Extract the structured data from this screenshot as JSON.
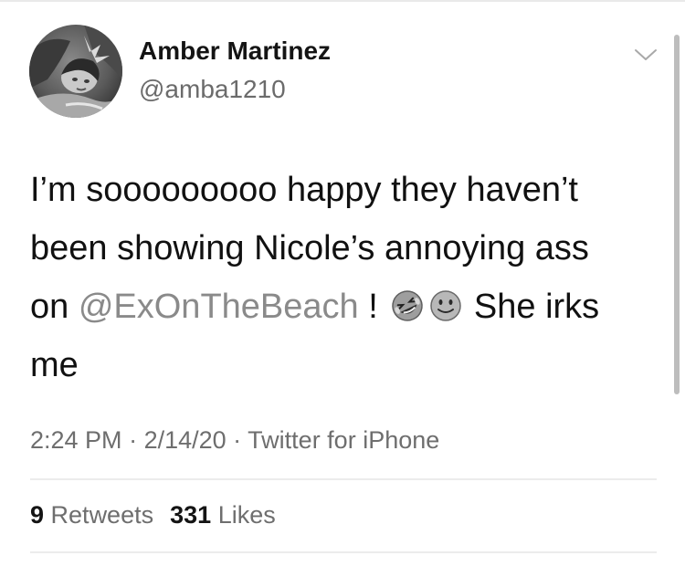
{
  "user": {
    "display_name": "Amber Martinez",
    "handle": "@amba1210"
  },
  "tweet": {
    "line1": "I’m sooooooooo happy they haven’t",
    "line2": "been showing Nicole’s annoying ass",
    "line3_prefix": "on ",
    "mention": "@ExOnTheBeach",
    "line3_after_mention": " ! ",
    "line3_suffix": " She irks",
    "line4": "me",
    "emojis": [
      "rolling-on-floor-laughing-emoji",
      "slightly-smiling-face-emoji"
    ]
  },
  "meta": {
    "time": "2:24 PM",
    "separator": " · ",
    "date": "2/14/20",
    "source": "Twitter for iPhone"
  },
  "stats": {
    "retweets_count": "9",
    "retweets_label": "Retweets",
    "likes_count": "331",
    "likes_label": "Likes"
  },
  "icons": {
    "menu": "chevron-down-icon"
  },
  "colors": {
    "text": "#111111",
    "secondary": "#6e6e6e",
    "mention": "#8a8a8a",
    "divider": "#ececec"
  }
}
